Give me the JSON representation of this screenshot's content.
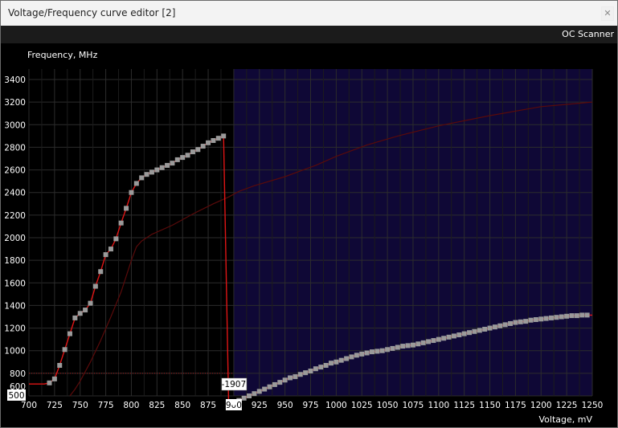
{
  "window": {
    "title": "Voltage/Frequency curve editor [2]",
    "close_glyph": "✕"
  },
  "toolbar": {
    "oc_scanner_label": "OC Scanner"
  },
  "colors": {
    "background": "#000000",
    "selection": "#0f0836",
    "grid": "#2c2c2c",
    "curve": "#e01515",
    "point": "#9a9a9a",
    "faint_curve": "#5a0a0a"
  },
  "chart_data": {
    "type": "line",
    "xlabel": "Voltage, mV",
    "ylabel": "Frequency, MHz",
    "xlim": [
      700,
      1250
    ],
    "ylim": [
      600,
      3400
    ],
    "x_ticks": [
      700,
      725,
      750,
      775,
      800,
      825,
      850,
      875,
      900,
      925,
      950,
      975,
      1000,
      1025,
      1050,
      1075,
      1100,
      1125,
      1150,
      1175,
      1200,
      1225,
      1250
    ],
    "y_ticks": [
      600,
      800,
      1000,
      1200,
      1400,
      1600,
      1800,
      2000,
      2200,
      2400,
      2600,
      2800,
      3000,
      3200,
      3400
    ],
    "selection_start_mV": 900,
    "highlighted_x_tick": "900",
    "offset_label": "-1907",
    "reference_label": "500",
    "reference_frequency": 800,
    "series": [
      {
        "role": "curve",
        "points": [
          [
            700,
            705
          ],
          [
            705,
            705
          ],
          [
            710,
            705
          ],
          [
            715,
            705
          ],
          [
            720,
            715
          ],
          [
            725,
            750
          ],
          [
            730,
            870
          ],
          [
            735,
            1010
          ],
          [
            740,
            1150
          ],
          [
            745,
            1290
          ],
          [
            750,
            1330
          ],
          [
            755,
            1360
          ],
          [
            760,
            1420
          ],
          [
            765,
            1570
          ],
          [
            770,
            1700
          ],
          [
            775,
            1850
          ],
          [
            780,
            1900
          ],
          [
            785,
            1990
          ],
          [
            790,
            2130
          ],
          [
            795,
            2260
          ],
          [
            800,
            2400
          ],
          [
            805,
            2480
          ],
          [
            810,
            2530
          ],
          [
            815,
            2560
          ],
          [
            820,
            2580
          ],
          [
            825,
            2600
          ],
          [
            830,
            2620
          ],
          [
            835,
            2640
          ],
          [
            840,
            2660
          ],
          [
            845,
            2690
          ],
          [
            850,
            2710
          ],
          [
            855,
            2730
          ],
          [
            860,
            2760
          ],
          [
            865,
            2780
          ],
          [
            870,
            2810
          ],
          [
            875,
            2840
          ],
          [
            880,
            2860
          ],
          [
            885,
            2880
          ],
          [
            890,
            2900
          ],
          [
            895,
            540
          ],
          [
            900,
            550
          ],
          [
            905,
            560
          ],
          [
            910,
            580
          ],
          [
            915,
            600
          ],
          [
            920,
            620
          ],
          [
            925,
            640
          ],
          [
            930,
            660
          ],
          [
            935,
            680
          ],
          [
            940,
            700
          ],
          [
            945,
            720
          ],
          [
            950,
            740
          ],
          [
            955,
            760
          ],
          [
            960,
            770
          ],
          [
            965,
            790
          ],
          [
            970,
            805
          ],
          [
            975,
            820
          ],
          [
            980,
            840
          ],
          [
            985,
            855
          ],
          [
            990,
            870
          ],
          [
            995,
            890
          ],
          [
            1000,
            900
          ],
          [
            1005,
            915
          ],
          [
            1010,
            930
          ],
          [
            1015,
            945
          ],
          [
            1020,
            960
          ],
          [
            1025,
            970
          ],
          [
            1030,
            980
          ],
          [
            1035,
            990
          ],
          [
            1040,
            995
          ],
          [
            1045,
            1000
          ],
          [
            1050,
            1010
          ],
          [
            1055,
            1020
          ],
          [
            1060,
            1030
          ],
          [
            1065,
            1040
          ],
          [
            1070,
            1045
          ],
          [
            1075,
            1050
          ],
          [
            1080,
            1060
          ],
          [
            1085,
            1070
          ],
          [
            1090,
            1080
          ],
          [
            1095,
            1090
          ],
          [
            1100,
            1100
          ],
          [
            1105,
            1110
          ],
          [
            1110,
            1120
          ],
          [
            1115,
            1130
          ],
          [
            1120,
            1140
          ],
          [
            1125,
            1150
          ],
          [
            1130,
            1160
          ],
          [
            1135,
            1170
          ],
          [
            1140,
            1180
          ],
          [
            1145,
            1190
          ],
          [
            1150,
            1200
          ],
          [
            1155,
            1210
          ],
          [
            1160,
            1220
          ],
          [
            1165,
            1230
          ],
          [
            1170,
            1240
          ],
          [
            1175,
            1250
          ],
          [
            1180,
            1255
          ],
          [
            1185,
            1260
          ],
          [
            1190,
            1270
          ],
          [
            1195,
            1275
          ],
          [
            1200,
            1280
          ],
          [
            1205,
            1285
          ],
          [
            1210,
            1290
          ],
          [
            1215,
            1295
          ],
          [
            1220,
            1300
          ],
          [
            1225,
            1305
          ],
          [
            1230,
            1310
          ],
          [
            1235,
            1310
          ],
          [
            1240,
            1315
          ],
          [
            1245,
            1315
          ],
          [
            1250,
            1315
          ]
        ]
      },
      {
        "role": "baseline",
        "points": [
          [
            740,
            600
          ],
          [
            745,
            660
          ],
          [
            750,
            730
          ],
          [
            760,
            900
          ],
          [
            770,
            1090
          ],
          [
            780,
            1300
          ],
          [
            790,
            1520
          ],
          [
            800,
            1800
          ],
          [
            805,
            1920
          ],
          [
            810,
            1970
          ],
          [
            820,
            2030
          ],
          [
            840,
            2110
          ],
          [
            860,
            2210
          ],
          [
            880,
            2300
          ],
          [
            895,
            2360
          ],
          [
            905,
            2410
          ],
          [
            920,
            2460
          ],
          [
            950,
            2540
          ],
          [
            980,
            2640
          ],
          [
            1000,
            2720
          ],
          [
            1030,
            2820
          ],
          [
            1060,
            2900
          ],
          [
            1100,
            2990
          ],
          [
            1150,
            3080
          ],
          [
            1200,
            3160
          ],
          [
            1225,
            3180
          ],
          [
            1250,
            3200
          ]
        ]
      }
    ]
  }
}
